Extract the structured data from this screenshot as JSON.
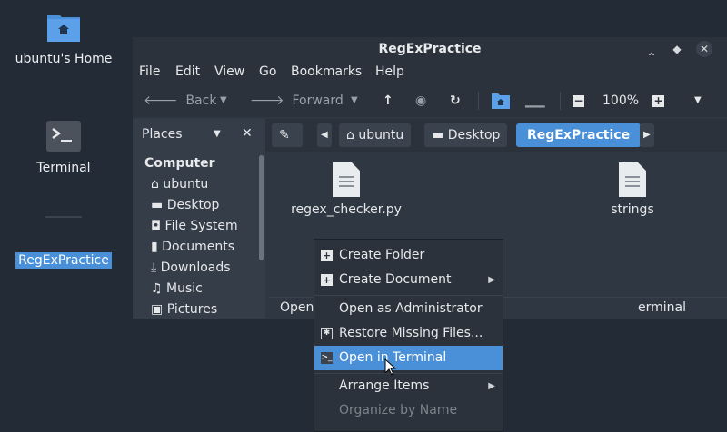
{
  "desktop": {
    "icons": [
      {
        "label": "ubuntu's Home"
      },
      {
        "label": "Terminal"
      },
      {
        "label": "RegExPractice"
      }
    ]
  },
  "window": {
    "title": "RegExPractice",
    "menus": [
      "File",
      "Edit",
      "View",
      "Go",
      "Bookmarks",
      "Help"
    ],
    "toolbar": {
      "back": "Back",
      "forward": "Forward",
      "zoom": "100%"
    },
    "sidebar": {
      "header": "Places",
      "section": "Computer",
      "items": [
        "ubuntu",
        "Desktop",
        "File System",
        "Documents",
        "Downloads",
        "Music",
        "Pictures"
      ]
    },
    "breadcrumbs": [
      "ubuntu",
      "Desktop",
      "RegExPractice"
    ],
    "files": [
      {
        "name": "regex_checker.py"
      },
      {
        "name": "strings"
      }
    ],
    "status_left": "Open",
    "status_right": "erminal"
  },
  "context_menu": {
    "items": [
      {
        "label": "Create Folder"
      },
      {
        "label": "Create Document"
      },
      {
        "label": "Open as Administrator"
      },
      {
        "label": "Restore Missing Files..."
      },
      {
        "label": "Open in Terminal"
      },
      {
        "label": "Arrange Items"
      },
      {
        "label": "Organize by Name"
      }
    ]
  },
  "colors": {
    "accent": "#4a90d9",
    "desktop_bg": "#232b37",
    "window_bg": "#2f3742"
  }
}
